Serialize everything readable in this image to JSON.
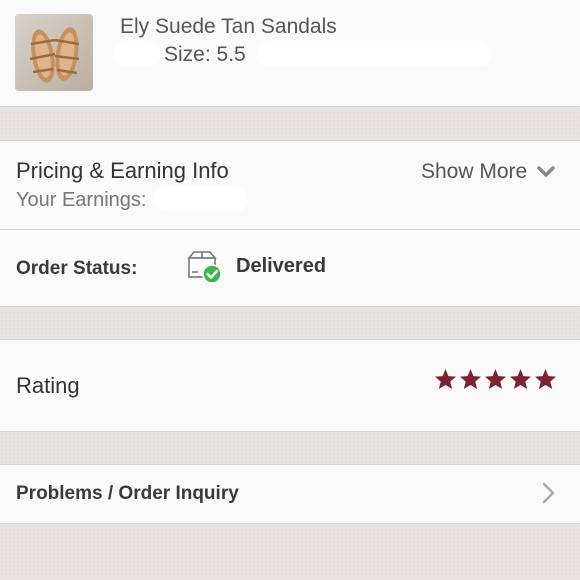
{
  "product": {
    "title": "Ely Suede Tan Sandals",
    "size_label": "Size: 5.5",
    "thumbnail_icon": "sandals-photo"
  },
  "pricing": {
    "title": "Pricing & Earning Info",
    "earnings_label": "Your Earnings:",
    "show_more_label": "Show More",
    "show_more_icon": "chevron-down-icon"
  },
  "order_status": {
    "label": "Order Status:",
    "value": "Delivered",
    "icon": "delivered-box-icon",
    "check_color": "#3cb54a"
  },
  "rating": {
    "label": "Rating",
    "stars": 5,
    "max_stars": 5,
    "star_color": "#7d2330"
  },
  "problems": {
    "label": "Problems / Order Inquiry",
    "icon": "chevron-right-icon"
  }
}
